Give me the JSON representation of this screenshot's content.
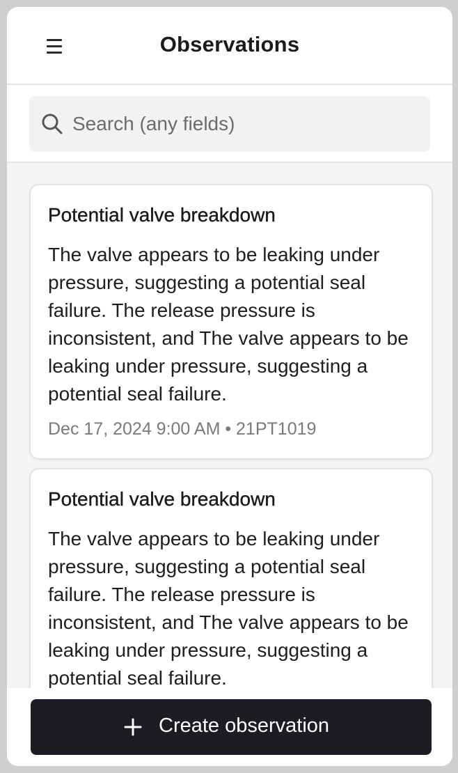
{
  "header": {
    "title": "Observations",
    "menu_icon": "hamburger-menu-icon"
  },
  "search": {
    "placeholder": "Search (any fields)",
    "value": "",
    "icon": "search-icon"
  },
  "observations": [
    {
      "title": "Potential valve breakdown",
      "body": "The valve appears to be leaking under pressure, suggesting a potential seal failure. The release pressure is inconsistent, and The valve appears to be leaking under pressure, suggesting a potential seal failure.",
      "meta": "Dec 17, 2024 9:00 AM • 21PT1019"
    },
    {
      "title": "Potential valve breakdown",
      "body": "The valve appears to be leaking under pressure, suggesting a potential seal failure. The release pressure is inconsistent, and The valve appears to be leaking under pressure, suggesting a potential seal failure."
    }
  ],
  "actions": {
    "create_label": "Create observation",
    "create_icon": "plus-icon"
  },
  "colors": {
    "primary_button": "#1b1d22",
    "background": "#f5f5f5",
    "card": "#ffffff",
    "meta_text": "#7a7a7a"
  }
}
